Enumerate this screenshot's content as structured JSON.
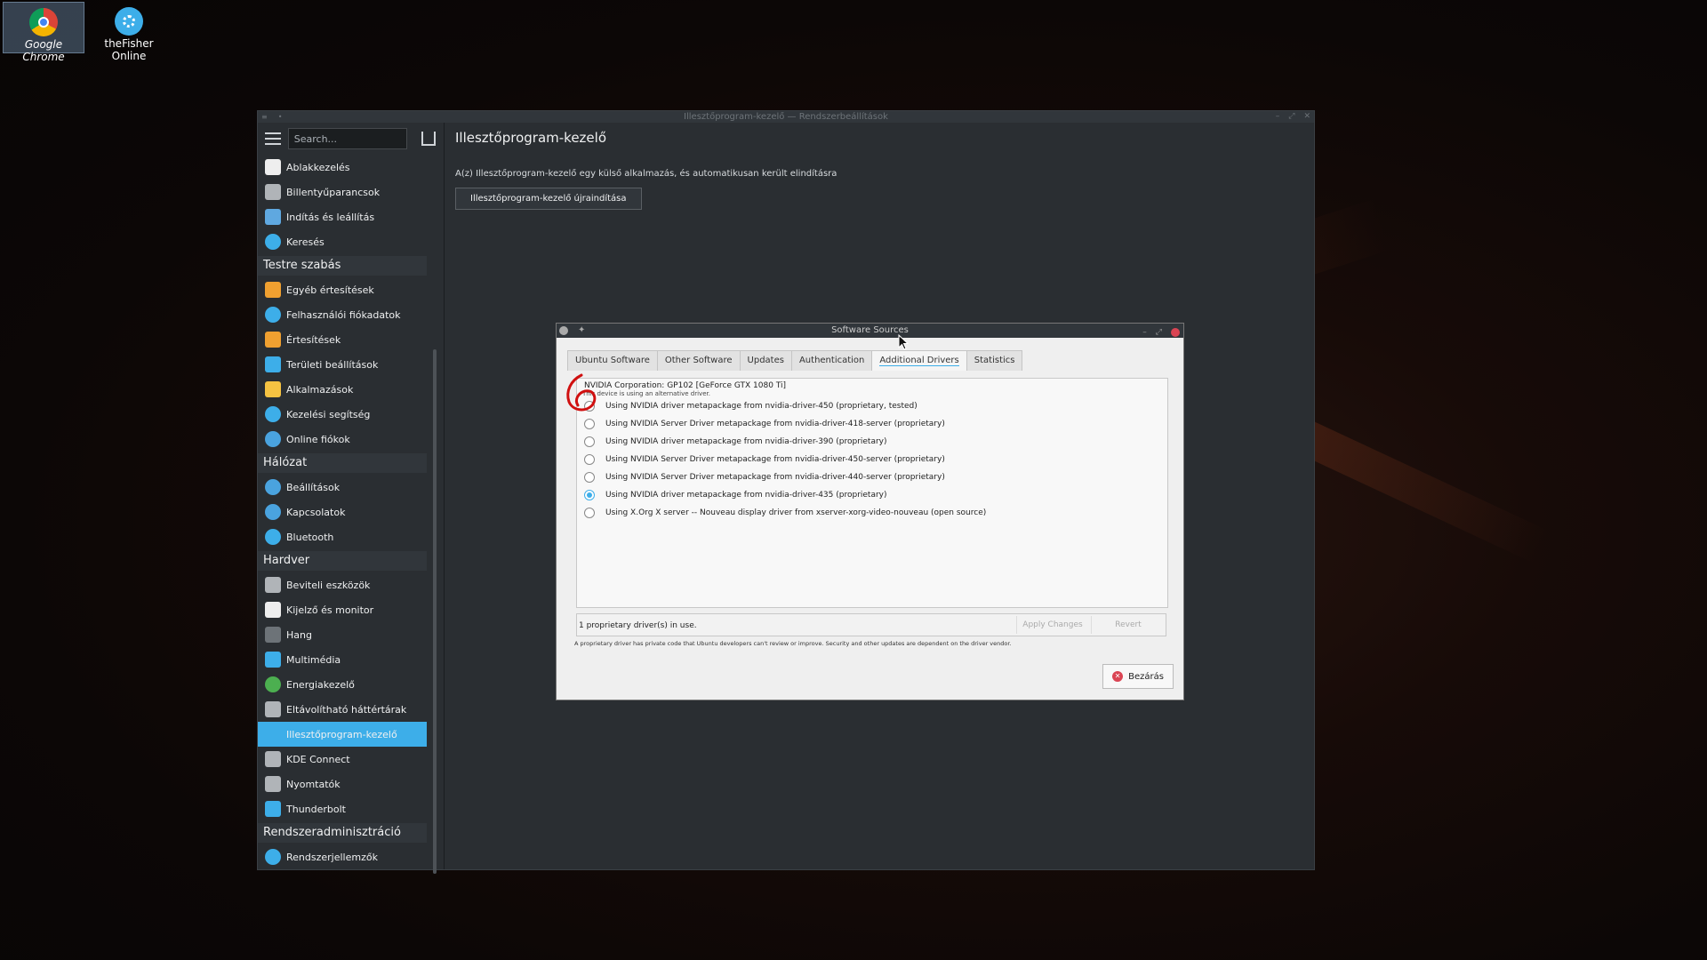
{
  "desktop": {
    "icons": [
      {
        "label": "Google Chrome",
        "icon": "chrome-icon"
      },
      {
        "label": "theFisher Online",
        "icon": "gear-icon"
      }
    ]
  },
  "window": {
    "title": "Illesztőprogram-kezelő — Rendszerbeállítások",
    "search_placeholder": "Search...",
    "sidebar": {
      "items_top": [
        {
          "label": "Ablakkezelés",
          "icon": "window-icon",
          "color": "#eeeeee"
        },
        {
          "label": "Billentyűparancsok",
          "icon": "keyboard-icon",
          "color": "#b0b4b8"
        },
        {
          "label": "Indítás és leállítás",
          "icon": "monitor-icon",
          "color": "#5fa8e0"
        },
        {
          "label": "Keresés",
          "icon": "search-icon",
          "color": "#3daee9"
        }
      ],
      "cat1": "Testre szabás",
      "items_cat1": [
        {
          "label": "Egyéb értesítések",
          "icon": "bell-icon",
          "color": "#f0a030"
        },
        {
          "label": "Felhasználói fiókadatok",
          "icon": "user-icon",
          "color": "#3daee9"
        },
        {
          "label": "Értesítések",
          "icon": "bell-icon",
          "color": "#f0a030"
        },
        {
          "label": "Területi beállítások",
          "icon": "monitor-icon",
          "color": "#3daee9"
        },
        {
          "label": "Alkalmazások",
          "icon": "star-icon",
          "color": "#f6c342"
        },
        {
          "label": "Kezelési segítség",
          "icon": "accessibility-icon",
          "color": "#3daee9"
        },
        {
          "label": "Online fiókok",
          "icon": "globe-icon",
          "color": "#4aa3df"
        }
      ],
      "cat2": "Hálózat",
      "items_cat2": [
        {
          "label": "Beállítások",
          "icon": "globe-icon",
          "color": "#4aa3df"
        },
        {
          "label": "Kapcsolatok",
          "icon": "globe-icon",
          "color": "#4aa3df"
        },
        {
          "label": "Bluetooth",
          "icon": "bluetooth-icon",
          "color": "#3daee9"
        }
      ],
      "cat3": "Hardver",
      "items_cat3": [
        {
          "label": "Beviteli eszközök",
          "icon": "keyboard-icon",
          "color": "#b0b4b8"
        },
        {
          "label": "Kijelző és monitor",
          "icon": "monitor-icon",
          "color": "#eeeeee"
        },
        {
          "label": "Hang",
          "icon": "speaker-icon",
          "color": "#6d7378"
        },
        {
          "label": "Multimédia",
          "icon": "multimedia-icon",
          "color": "#3daee9"
        },
        {
          "label": "Energiakezelő",
          "icon": "power-icon",
          "color": "#4caf50"
        },
        {
          "label": "Eltávolítható háttértárak",
          "icon": "usb-icon",
          "color": "#b0b4b8"
        },
        {
          "label": "Illesztőprogram-kezelő",
          "icon": "driver-icon",
          "color": "#3daee9",
          "active": true
        },
        {
          "label": "KDE Connect",
          "icon": "phone-icon",
          "color": "#b0b4b8"
        },
        {
          "label": "Nyomtatók",
          "icon": "printer-icon",
          "color": "#b0b4b8"
        },
        {
          "label": "Thunderbolt",
          "icon": "thunderbolt-icon",
          "color": "#3daee9"
        }
      ],
      "cat4": "Rendszeradminisztráció",
      "items_cat4": [
        {
          "label": "Rendszerjellemzők",
          "icon": "info-icon",
          "color": "#3daee9"
        }
      ]
    },
    "page_title": "Illesztőprogram-kezelő",
    "message": "A(z) Illesztőprogram-kezelő egy külső alkalmazás, és automatikusan került elindításra",
    "restart_label": "Illesztőprogram-kezelő újraindítása"
  },
  "dialog": {
    "title": "Software Sources",
    "tabs": [
      "Ubuntu Software",
      "Other Software",
      "Updates",
      "Authentication",
      "Additional Drivers",
      "Statistics"
    ],
    "active_tab": "Additional Drivers",
    "device": "NVIDIA Corporation: GP102 [GeForce GTX 1080 Ti]",
    "device_sub": "This device is using an alternative driver.",
    "drivers": [
      {
        "label": "Using NVIDIA driver metapackage from nvidia-driver-450 (proprietary, tested)",
        "selected": false
      },
      {
        "label": "Using NVIDIA Server Driver metapackage from nvidia-driver-418-server (proprietary)",
        "selected": false
      },
      {
        "label": "Using NVIDIA driver metapackage from nvidia-driver-390 (proprietary)",
        "selected": false
      },
      {
        "label": "Using NVIDIA Server Driver metapackage from nvidia-driver-450-server (proprietary)",
        "selected": false
      },
      {
        "label": "Using NVIDIA Server Driver metapackage from nvidia-driver-440-server (proprietary)",
        "selected": false
      },
      {
        "label": "Using NVIDIA driver metapackage from nvidia-driver-435 (proprietary)",
        "selected": true
      },
      {
        "label": "Using X.Org X server -- Nouveau display driver from xserver-xorg-video-nouveau (open source)",
        "selected": false
      }
    ],
    "status": "1 proprietary driver(s) in use.",
    "apply_label": "Apply Changes",
    "revert_label": "Revert",
    "note": "A proprietary driver has private code that Ubuntu developers can't review or improve. Security and other updates are dependent on the driver vendor.",
    "close_label": "Bezárás"
  },
  "annotation_color": "#d01010"
}
